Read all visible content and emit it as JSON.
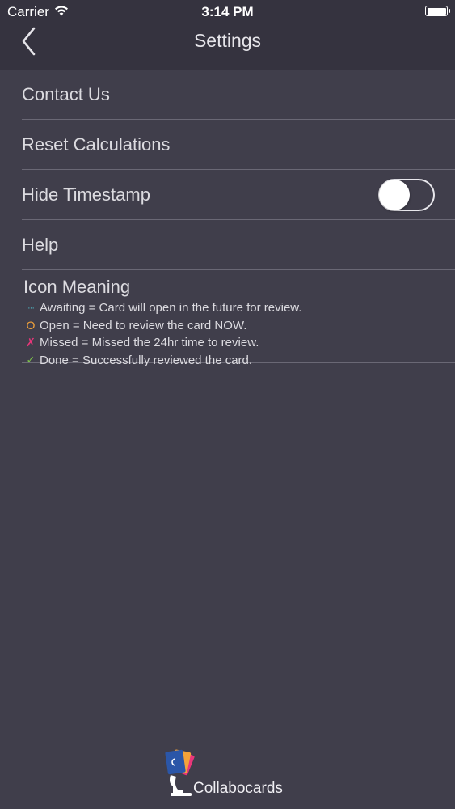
{
  "status_bar": {
    "carrier": "Carrier",
    "time": "3:14 PM"
  },
  "nav": {
    "title": "Settings",
    "back_icon": "chevron-left-icon"
  },
  "settings": {
    "contact_us": "Contact Us",
    "reset_calculations": "Reset Calculations",
    "hide_timestamp": "Hide Timestamp",
    "hide_timestamp_on": false,
    "help": "Help"
  },
  "icon_meaning": {
    "title": "Icon Meaning",
    "items": [
      {
        "glyph": "···",
        "text": "Awaiting = Card will open in the future for review.",
        "color": "#4fb6c3"
      },
      {
        "glyph": "O",
        "text": "Open = Need to review the card NOW.",
        "color": "#f3a23a"
      },
      {
        "glyph": "✗",
        "text": "Missed = Missed the 24hr time to review.",
        "color": "#e9367a"
      },
      {
        "glyph": "✓",
        "text": "Done = Successfully reviewed the card.",
        "color": "#7cc24a"
      }
    ]
  },
  "brand": {
    "name": "Collabocards"
  },
  "colors": {
    "background": "#403e4b",
    "bar": "#35333f",
    "divider": "#6a6875"
  }
}
